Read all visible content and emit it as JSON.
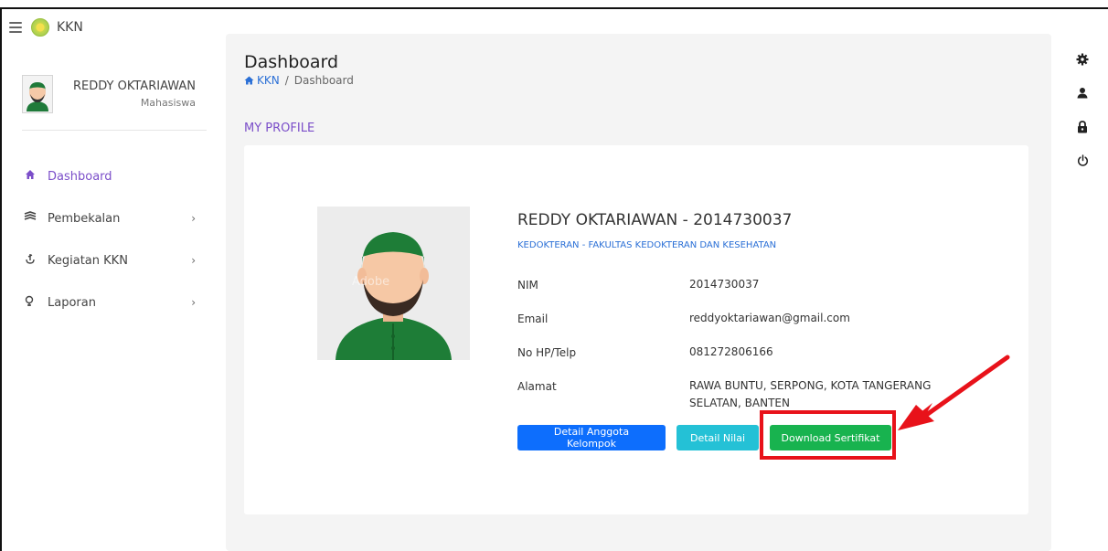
{
  "brand": {
    "name": "KKN"
  },
  "user": {
    "name": "REDDY OKTARIAWAN",
    "role": "Mahasiswa"
  },
  "sidebar": {
    "items": [
      {
        "label": "Dashboard",
        "icon": "home-icon",
        "active": true
      },
      {
        "label": "Pembekalan",
        "icon": "layers-icon"
      },
      {
        "label": "Kegiatan KKN",
        "icon": "activity-icon"
      },
      {
        "label": "Laporan",
        "icon": "report-icon"
      }
    ]
  },
  "main": {
    "title": "Dashboard",
    "breadcrumb": {
      "home": "KKN",
      "sep": "/",
      "current": "Dashboard"
    },
    "section_title": "MY PROFILE"
  },
  "profile": {
    "heading": "REDDY OKTARIAWAN - 2014730037",
    "faculty": "KEDOKTERAN - FAKULTAS KEDOKTERAN DAN KESEHATAN",
    "fields": [
      {
        "label": "NIM",
        "value": "2014730037"
      },
      {
        "label": "Email",
        "value": "reddyoktariawan@gmail.com"
      },
      {
        "label": "No HP/Telp",
        "value": "081272806166"
      },
      {
        "label": "Alamat",
        "value": "RAWA BUNTU, SERPONG, KOTA TANGERANG SELATAN, BANTEN"
      }
    ],
    "buttons": {
      "detail_anggota": "Detail Anggota Kelompok",
      "detail_nilai": "Detail Nilai",
      "download_sertifikat": "Download Sertifikat"
    }
  },
  "right_icons": [
    "gear-icon",
    "user-icon",
    "lock-icon",
    "power-icon"
  ],
  "colors": {
    "accent": "#7b4ec9",
    "link": "#2a6fd6",
    "btn_primary": "#0d6efd",
    "btn_info": "#24c1d6",
    "btn_success": "#18b34f",
    "annotation": "#e8121a"
  }
}
